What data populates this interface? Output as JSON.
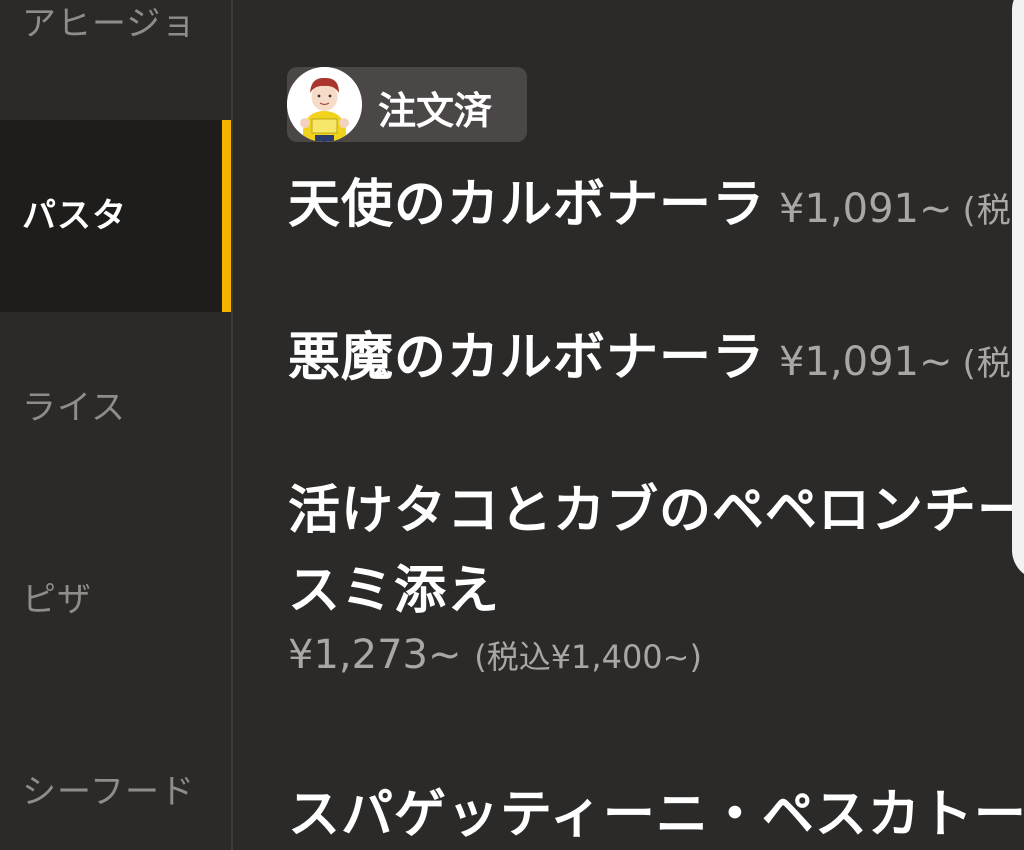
{
  "categories": [
    {
      "label": "アヒージョ",
      "active": false
    },
    {
      "label": "パスタ",
      "active": true
    },
    {
      "label": "ライス",
      "active": false
    },
    {
      "label": "ピザ",
      "active": false
    },
    {
      "label": "シーフード",
      "active": false
    }
  ],
  "ordered_badge": {
    "label": "注文済"
  },
  "items": [
    {
      "name": "天使のカルボナーラ",
      "price": "¥1,091~",
      "tax_partial": "(税"
    },
    {
      "name": "悪魔のカルボナーラ",
      "price": "¥1,091~",
      "tax_partial": "(税"
    },
    {
      "name_line1": "活けタコとカブのペペロンチー",
      "name_line2": "スミ添え",
      "price": "¥1,273~",
      "tax": "(税込¥1,400~)"
    },
    {
      "name": "スパゲッティーニ・ペスカトー"
    }
  ],
  "colors": {
    "background": "#2c2a29",
    "sidebar_active_bg": "#1f1d1c",
    "accent": "#f3b400",
    "text_primary": "#ffffff",
    "text_muted": "#8f8c8a"
  }
}
